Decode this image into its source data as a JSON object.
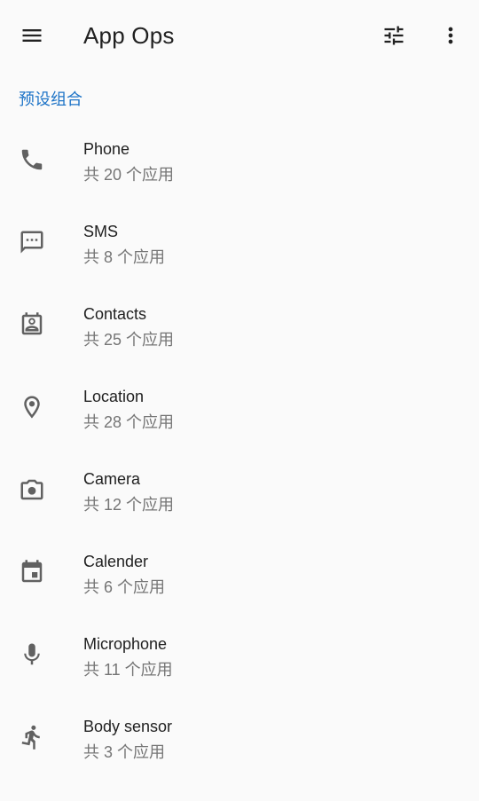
{
  "toolbar": {
    "title": "App Ops",
    "icons": [
      "menu-icon",
      "tune-icon",
      "more-vert-icon"
    ]
  },
  "section": {
    "header": "预设组合"
  },
  "items": [
    {
      "title": "Phone",
      "subtitle": "共 20 个应用",
      "icon": "phone-icon"
    },
    {
      "title": "SMS",
      "subtitle": "共 8 个应用",
      "icon": "sms-icon"
    },
    {
      "title": "Contacts",
      "subtitle": "共 25 个应用",
      "icon": "contacts-icon"
    },
    {
      "title": "Location",
      "subtitle": "共 28 个应用",
      "icon": "location-icon"
    },
    {
      "title": "Camera",
      "subtitle": "共 12 个应用",
      "icon": "camera-icon"
    },
    {
      "title": "Calender",
      "subtitle": "共 6 个应用",
      "icon": "calendar-icon"
    },
    {
      "title": "Microphone",
      "subtitle": "共 11 个应用",
      "icon": "microphone-icon"
    },
    {
      "title": "Body sensor",
      "subtitle": "共 3 个应用",
      "icon": "body-sensor-icon"
    }
  ],
  "colors": {
    "accent": "#1e74c7",
    "icon": "#616161",
    "title": "#212121",
    "subtitle": "#757575",
    "background": "#fafafa"
  }
}
